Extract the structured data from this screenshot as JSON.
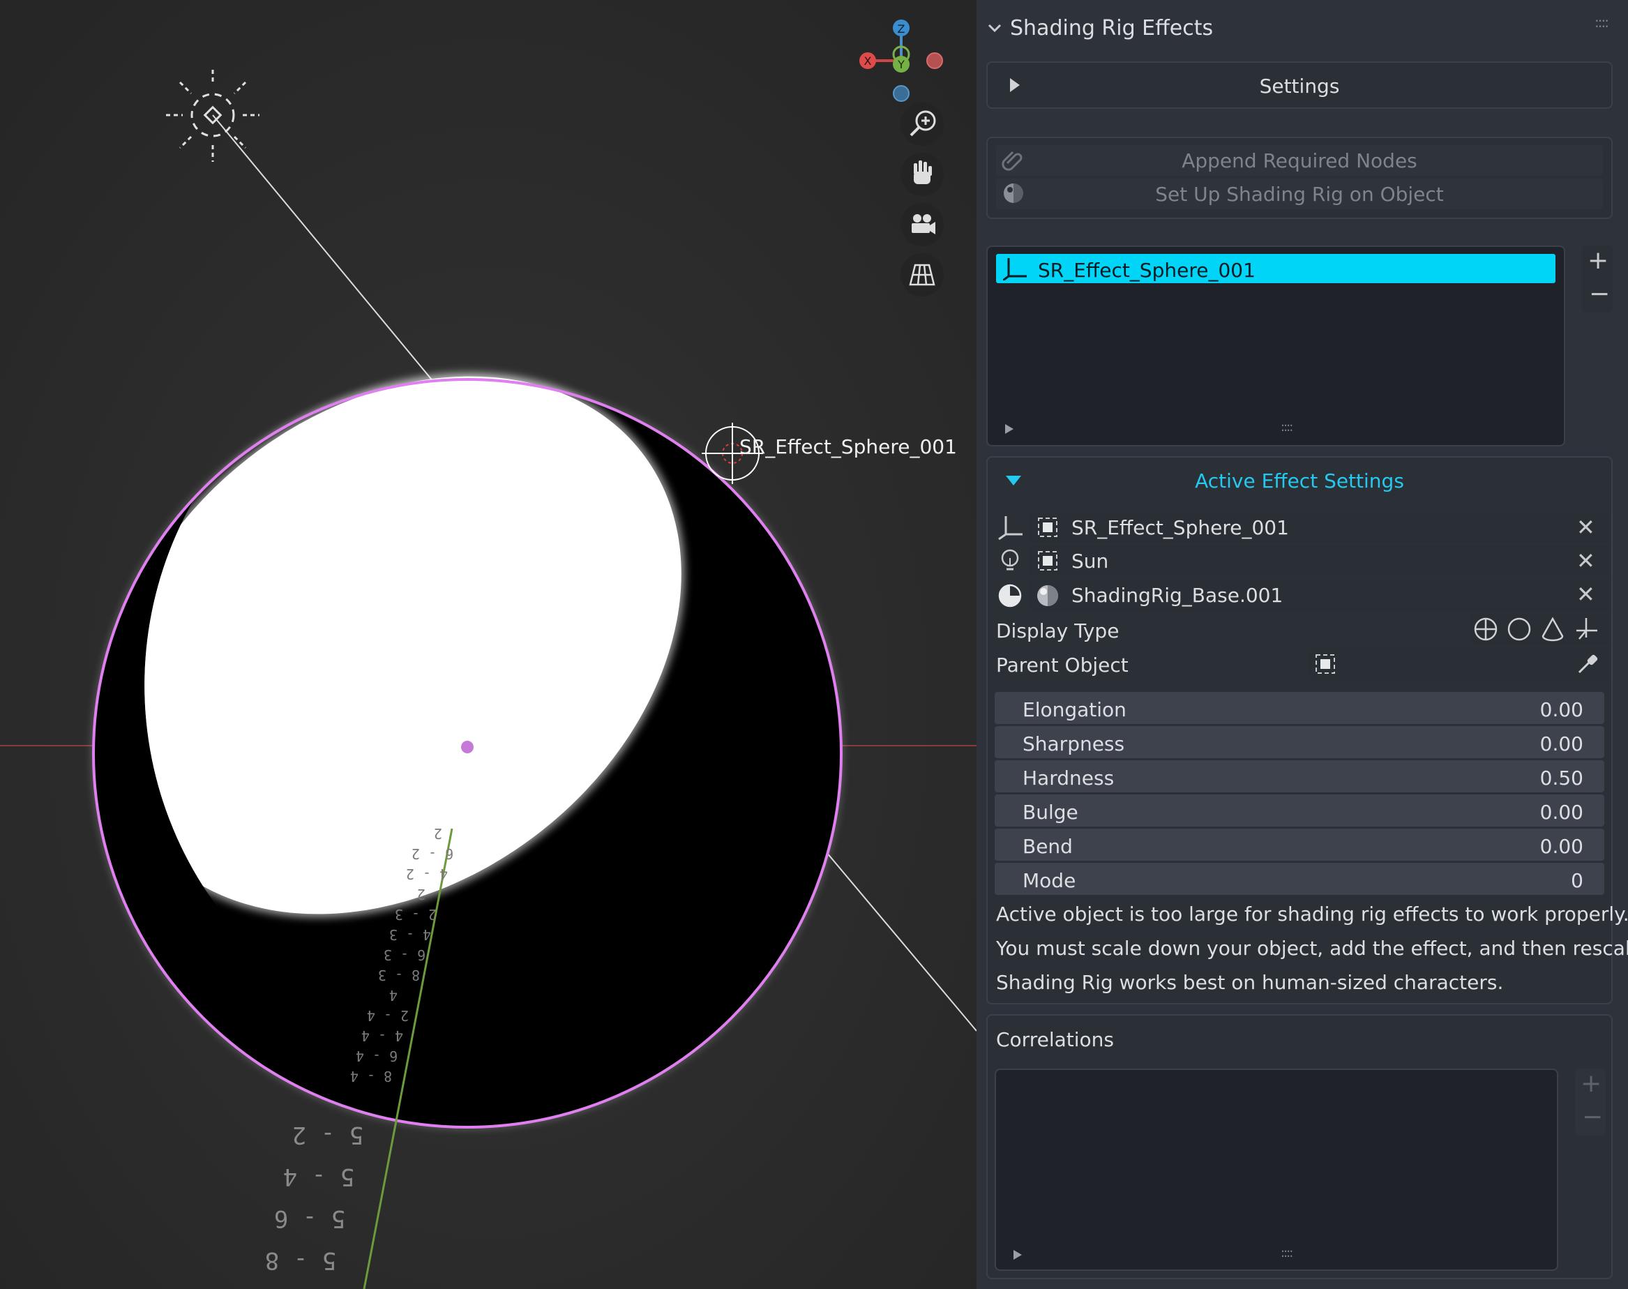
{
  "viewport": {
    "object_label": "SR_Effect_Sphere_001",
    "gizmo_axes": {
      "x": "X",
      "y": "Y",
      "z": "Z"
    },
    "tools": [
      "zoom-icon",
      "pan-hand-icon",
      "camera-icon",
      "grid-perspective-icon"
    ],
    "ruler_labels_near": [
      "2",
      "6 - 2",
      "4 - 2",
      "2",
      "2 - 3",
      "4 - 3",
      "6 - 3",
      "8 - 3",
      "4",
      "2 - 4",
      "4 - 4",
      "6 - 4",
      "8 - 4"
    ],
    "ruler_labels_far": [
      "5 - 2",
      "5 - 4",
      "5 - 6",
      "5 - 8"
    ],
    "colors": {
      "outline": "#e07ff0",
      "x_axis": "#b84a4a",
      "y_axis": "#6c9a3c",
      "origin_dot": "#c67ad8"
    }
  },
  "panel": {
    "title": "Shading Rig Effects",
    "settings_label": "Settings",
    "append_label": "Append Required Nodes",
    "setup_label": "Set Up Shading Rig on Object",
    "effects_list": [
      {
        "label": "SR_Effect_Sphere_001",
        "selected": true
      }
    ],
    "add_label": "+",
    "remove_label": "−",
    "active_header": "Active Effect Settings",
    "object_refs": [
      {
        "label": "SR_Effect_Sphere_001",
        "icon": "empty-axes-icon"
      },
      {
        "label": "Sun",
        "icon": "light-icon"
      },
      {
        "label": "ShadingRig_Base.001",
        "icon": "material-icon"
      }
    ],
    "display_type_label": "Display Type",
    "parent_object_label": "Parent Object",
    "fields": [
      {
        "label": "Elongation",
        "value": "0.00"
      },
      {
        "label": "Sharpness",
        "value": "0.00"
      },
      {
        "label": "Hardness",
        "value": "0.50"
      },
      {
        "label": "Bulge",
        "value": "0.00"
      },
      {
        "label": "Bend",
        "value": "0.00"
      },
      {
        "label": "Mode",
        "value": "0"
      }
    ],
    "warning_lines": [
      "Active object is too large for shading rig effects to work properly.",
      "You must scale down your object, add the effect, and then rescale.",
      "Shading Rig works best on human-sized characters."
    ],
    "correlations_label": "Correlations",
    "accent_color": "#00d5f7"
  }
}
